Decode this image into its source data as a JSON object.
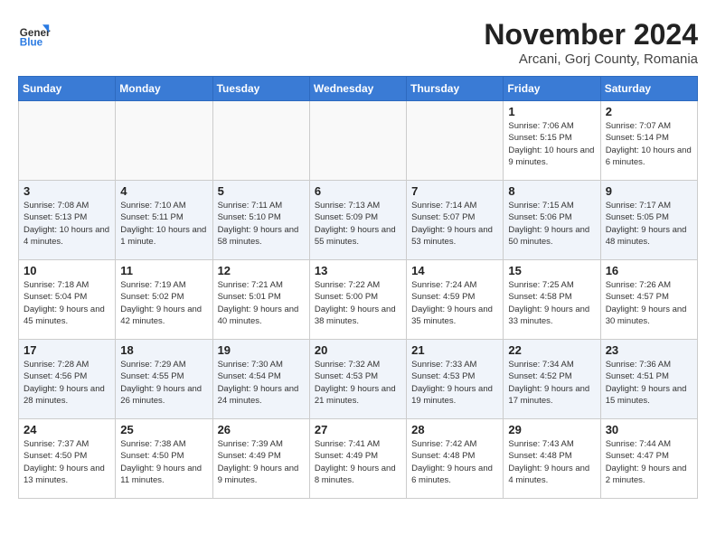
{
  "logo": {
    "general": "General",
    "blue": "Blue"
  },
  "header": {
    "month_year": "November 2024",
    "location": "Arcani, Gorj County, Romania"
  },
  "weekdays": [
    "Sunday",
    "Monday",
    "Tuesday",
    "Wednesday",
    "Thursday",
    "Friday",
    "Saturday"
  ],
  "weeks": [
    [
      {
        "day": "",
        "info": ""
      },
      {
        "day": "",
        "info": ""
      },
      {
        "day": "",
        "info": ""
      },
      {
        "day": "",
        "info": ""
      },
      {
        "day": "",
        "info": ""
      },
      {
        "day": "1",
        "info": "Sunrise: 7:06 AM\nSunset: 5:15 PM\nDaylight: 10 hours and 9 minutes."
      },
      {
        "day": "2",
        "info": "Sunrise: 7:07 AM\nSunset: 5:14 PM\nDaylight: 10 hours and 6 minutes."
      }
    ],
    [
      {
        "day": "3",
        "info": "Sunrise: 7:08 AM\nSunset: 5:13 PM\nDaylight: 10 hours and 4 minutes."
      },
      {
        "day": "4",
        "info": "Sunrise: 7:10 AM\nSunset: 5:11 PM\nDaylight: 10 hours and 1 minute."
      },
      {
        "day": "5",
        "info": "Sunrise: 7:11 AM\nSunset: 5:10 PM\nDaylight: 9 hours and 58 minutes."
      },
      {
        "day": "6",
        "info": "Sunrise: 7:13 AM\nSunset: 5:09 PM\nDaylight: 9 hours and 55 minutes."
      },
      {
        "day": "7",
        "info": "Sunrise: 7:14 AM\nSunset: 5:07 PM\nDaylight: 9 hours and 53 minutes."
      },
      {
        "day": "8",
        "info": "Sunrise: 7:15 AM\nSunset: 5:06 PM\nDaylight: 9 hours and 50 minutes."
      },
      {
        "day": "9",
        "info": "Sunrise: 7:17 AM\nSunset: 5:05 PM\nDaylight: 9 hours and 48 minutes."
      }
    ],
    [
      {
        "day": "10",
        "info": "Sunrise: 7:18 AM\nSunset: 5:04 PM\nDaylight: 9 hours and 45 minutes."
      },
      {
        "day": "11",
        "info": "Sunrise: 7:19 AM\nSunset: 5:02 PM\nDaylight: 9 hours and 42 minutes."
      },
      {
        "day": "12",
        "info": "Sunrise: 7:21 AM\nSunset: 5:01 PM\nDaylight: 9 hours and 40 minutes."
      },
      {
        "day": "13",
        "info": "Sunrise: 7:22 AM\nSunset: 5:00 PM\nDaylight: 9 hours and 38 minutes."
      },
      {
        "day": "14",
        "info": "Sunrise: 7:24 AM\nSunset: 4:59 PM\nDaylight: 9 hours and 35 minutes."
      },
      {
        "day": "15",
        "info": "Sunrise: 7:25 AM\nSunset: 4:58 PM\nDaylight: 9 hours and 33 minutes."
      },
      {
        "day": "16",
        "info": "Sunrise: 7:26 AM\nSunset: 4:57 PM\nDaylight: 9 hours and 30 minutes."
      }
    ],
    [
      {
        "day": "17",
        "info": "Sunrise: 7:28 AM\nSunset: 4:56 PM\nDaylight: 9 hours and 28 minutes."
      },
      {
        "day": "18",
        "info": "Sunrise: 7:29 AM\nSunset: 4:55 PM\nDaylight: 9 hours and 26 minutes."
      },
      {
        "day": "19",
        "info": "Sunrise: 7:30 AM\nSunset: 4:54 PM\nDaylight: 9 hours and 24 minutes."
      },
      {
        "day": "20",
        "info": "Sunrise: 7:32 AM\nSunset: 4:53 PM\nDaylight: 9 hours and 21 minutes."
      },
      {
        "day": "21",
        "info": "Sunrise: 7:33 AM\nSunset: 4:53 PM\nDaylight: 9 hours and 19 minutes."
      },
      {
        "day": "22",
        "info": "Sunrise: 7:34 AM\nSunset: 4:52 PM\nDaylight: 9 hours and 17 minutes."
      },
      {
        "day": "23",
        "info": "Sunrise: 7:36 AM\nSunset: 4:51 PM\nDaylight: 9 hours and 15 minutes."
      }
    ],
    [
      {
        "day": "24",
        "info": "Sunrise: 7:37 AM\nSunset: 4:50 PM\nDaylight: 9 hours and 13 minutes."
      },
      {
        "day": "25",
        "info": "Sunrise: 7:38 AM\nSunset: 4:50 PM\nDaylight: 9 hours and 11 minutes."
      },
      {
        "day": "26",
        "info": "Sunrise: 7:39 AM\nSunset: 4:49 PM\nDaylight: 9 hours and 9 minutes."
      },
      {
        "day": "27",
        "info": "Sunrise: 7:41 AM\nSunset: 4:49 PM\nDaylight: 9 hours and 8 minutes."
      },
      {
        "day": "28",
        "info": "Sunrise: 7:42 AM\nSunset: 4:48 PM\nDaylight: 9 hours and 6 minutes."
      },
      {
        "day": "29",
        "info": "Sunrise: 7:43 AM\nSunset: 4:48 PM\nDaylight: 9 hours and 4 minutes."
      },
      {
        "day": "30",
        "info": "Sunrise: 7:44 AM\nSunset: 4:47 PM\nDaylight: 9 hours and 2 minutes."
      }
    ]
  ]
}
